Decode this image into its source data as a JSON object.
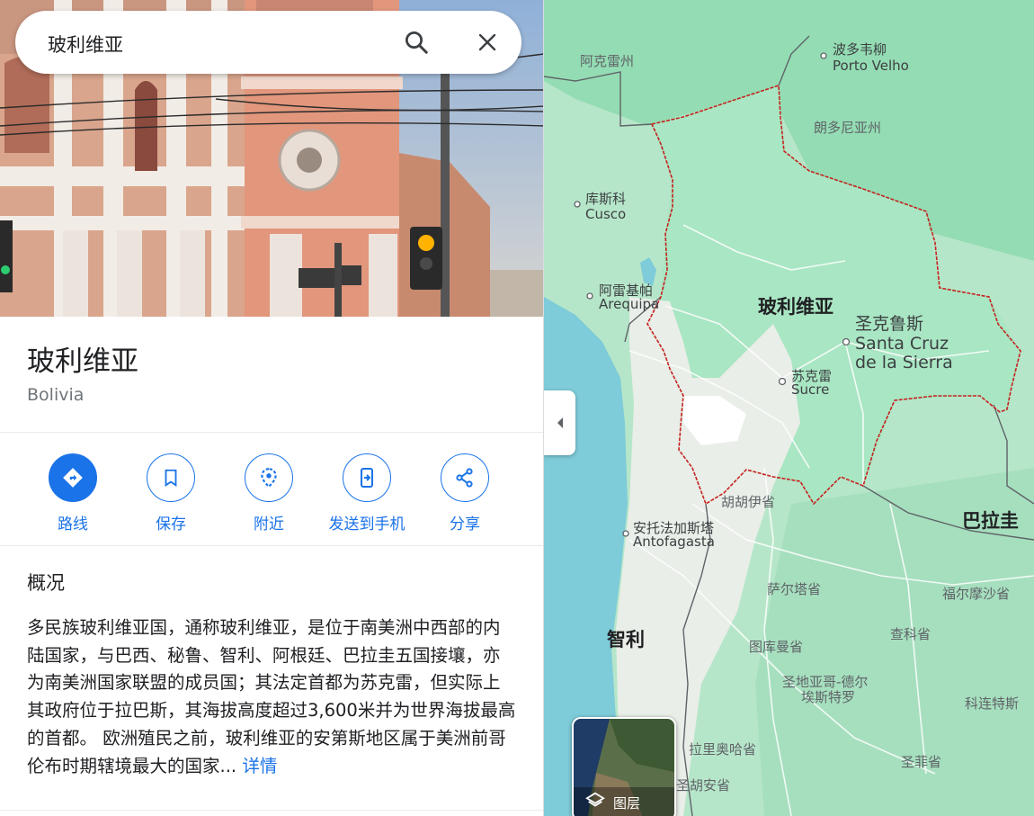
{
  "search": {
    "query": "玻利维亚"
  },
  "place": {
    "title": "玻利维亚",
    "subtitle": "Bolivia"
  },
  "actions": [
    {
      "label": "路线",
      "icon": "directions-icon"
    },
    {
      "label": "保存",
      "icon": "bookmark-icon"
    },
    {
      "label": "附近",
      "icon": "nearby-icon"
    },
    {
      "label": "发送到手机",
      "icon": "send-to-phone-icon"
    },
    {
      "label": "分享",
      "icon": "share-icon"
    }
  ],
  "overview": {
    "heading": "概况",
    "text": "多民族玻利维亚国，通称玻利维亚，是位于南美洲中西部的内陆国家，与巴西、秘鲁、智利、阿根廷、巴拉圭五国接壤，亦为南美洲国家联盟的成员国；其法定首都为苏克雷，但实际上其政府位于拉巴斯，其海拔高度超过3,600米并为世界海拔最高的首都。 欧洲殖民之前，玻利维亚的安第斯地区属于美洲前哥伦布时期辖境最大的国家...",
    "more_label": "详情"
  },
  "map": {
    "labels": {
      "acre": "阿克雷州",
      "porto_velho_cn": "波多韦柳",
      "porto_velho_en": "Porto Velho",
      "rondonia": "朗多尼亚州",
      "cusco_cn": "库斯科",
      "cusco_en": "Cusco",
      "arequipa_cn": "阿雷基帕",
      "arequipa_en": "Arequipa",
      "bolivia": "玻利维亚",
      "santa_cruz_cn": "圣克鲁斯",
      "santa_cruz_en1": "Santa Cruz",
      "santa_cruz_en2": "de la Sierra",
      "sucre_cn": "苏克雷",
      "sucre_en": "Sucre",
      "jujuy": "胡胡伊省",
      "paraguay": "巴拉圭",
      "antofagasta_cn": "安托法加斯塔",
      "antofagasta_en": "Antofagasta",
      "salta": "萨尔塔省",
      "formosa": "福尔摩沙省",
      "chile": "智利",
      "catamarca": "图库曼省",
      "chaco": "查科省",
      "santiago_del_estero1": "圣地亚哥-德尔",
      "santiago_del_estero2": "埃斯特罗",
      "corrientes": "科连特斯",
      "la_rioja": "拉里奥哈省",
      "santa_fe": "圣菲省",
      "san_juan": "圣胡安省"
    },
    "layers_label": "图层"
  },
  "colors": {
    "accent": "#1a73e8",
    "border": "#c5221f",
    "forest": "#8ddcae",
    "land": "#e6ede6",
    "water": "#7ecbd9"
  }
}
